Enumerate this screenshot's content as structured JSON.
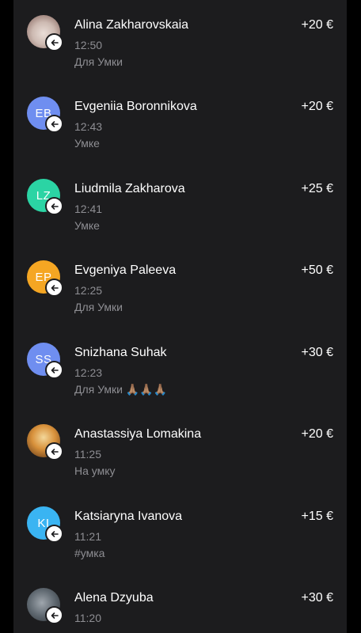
{
  "colors": {
    "page_background": "#000000",
    "panel_background": "#1c1c1e",
    "primary_text": "#ffffff",
    "secondary_text": "#8e8e93",
    "badge_background": "#ffffff",
    "badge_icon": "#1c1c1e"
  },
  "transactions": [
    {
      "name": "Alina Zakharovskaia",
      "time": "12:50",
      "comment": "Для Умки",
      "amount": "+20 €",
      "avatar": {
        "type": "photo",
        "icon": "cat-photo-avatar"
      }
    },
    {
      "name": "Evgeniia Boronnikova",
      "time": "12:43",
      "comment": "Умке",
      "amount": "+20 €",
      "avatar": {
        "type": "initials",
        "initials": "EB",
        "color": "#6f8ef0"
      }
    },
    {
      "name": "Liudmila Zakharova",
      "time": "12:41",
      "comment": "Умке",
      "amount": "+25 €",
      "avatar": {
        "type": "initials",
        "initials": "LZ",
        "color": "#2bd4a4"
      }
    },
    {
      "name": "Evgeniya Paleeva",
      "time": "12:25",
      "comment": "Для Умки",
      "amount": "+50 €",
      "avatar": {
        "type": "initials",
        "initials": "EP",
        "color": "#f5a623"
      }
    },
    {
      "name": "Snizhana Suhak",
      "time": "12:23",
      "comment": "Для Умки 🙏🏽🙏🏽🙏🏽",
      "amount": "+30 €",
      "avatar": {
        "type": "initials",
        "initials": "SS",
        "color": "#6f8ef0"
      }
    },
    {
      "name": "Anastassiya Lomakina",
      "time": "11:25",
      "comment": "На умку",
      "amount": "+20 €",
      "avatar": {
        "type": "photo",
        "icon": "dog-photo-avatar"
      }
    },
    {
      "name": "Katsiaryna Ivanova",
      "time": "11:21",
      "comment": "#умка",
      "amount": "+15 €",
      "avatar": {
        "type": "initials",
        "initials": "KI",
        "color": "#3ab4f2"
      }
    },
    {
      "name": "Alena Dzyuba",
      "time": "11:20",
      "comment": "",
      "amount": "+30 €",
      "avatar": {
        "type": "photo",
        "icon": "person-photo-avatar"
      }
    }
  ]
}
